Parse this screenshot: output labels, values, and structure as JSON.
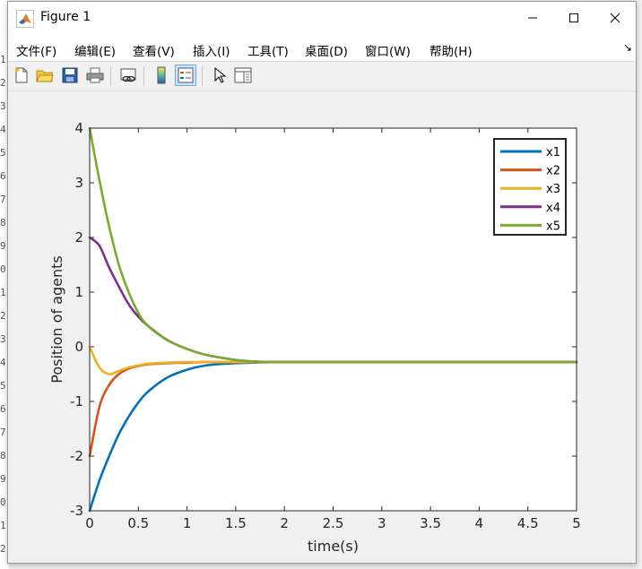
{
  "window": {
    "title": "Figure 1"
  },
  "menu": [
    {
      "label": "文件(F)"
    },
    {
      "label": "编辑(E)"
    },
    {
      "label": "查看(V)"
    },
    {
      "label": "插入(I)"
    },
    {
      "label": "工具(T)"
    },
    {
      "label": "桌面(D)"
    },
    {
      "label": "窗口(W)"
    },
    {
      "label": "帮助(H)"
    }
  ],
  "toolbar": [
    {
      "icon": "new-figure-icon"
    },
    {
      "icon": "open-file-icon"
    },
    {
      "icon": "save-icon"
    },
    {
      "icon": "print-icon"
    },
    {
      "icon": "link-plot-icon"
    },
    {
      "icon": "colorbar-icon"
    },
    {
      "icon": "legend-icon",
      "active": true
    },
    {
      "icon": "edit-plot-cursor-icon"
    },
    {
      "icon": "property-inspector-icon"
    }
  ],
  "colors": {
    "x1": "#0072BD",
    "x2": "#D95319",
    "x3": "#EDB120",
    "x4": "#7E2F8E",
    "x5": "#77AC30"
  },
  "chart_data": {
    "type": "line",
    "xlabel": "time(s)",
    "ylabel": "Position of agents",
    "xlim": [
      0,
      5
    ],
    "ylim": [
      -3,
      4
    ],
    "xticks": [
      "0",
      "0.5",
      "1",
      "1.5",
      "2",
      "2.5",
      "3",
      "3.5",
      "4",
      "4.5",
      "5"
    ],
    "yticks": [
      "-3",
      "-2",
      "-1",
      "0",
      "1",
      "2",
      "3",
      "4"
    ],
    "legend_position": "top-right",
    "grid": false,
    "x": [
      0,
      0.1,
      0.2,
      0.3,
      0.4,
      0.5,
      0.6,
      0.8,
      1.0,
      1.2,
      1.5,
      1.7,
      2.0,
      3.0,
      4.0,
      5.0
    ],
    "series": [
      {
        "name": "x1",
        "values": [
          -3,
          -2.45,
          -2.0,
          -1.6,
          -1.28,
          -1.02,
          -0.82,
          -0.56,
          -0.42,
          -0.34,
          -0.3,
          -0.29,
          -0.28,
          -0.28,
          -0.28,
          -0.28
        ]
      },
      {
        "name": "x2",
        "values": [
          -2,
          -1.1,
          -0.7,
          -0.5,
          -0.4,
          -0.35,
          -0.32,
          -0.3,
          -0.29,
          -0.28,
          -0.28,
          -0.28,
          -0.28,
          -0.28,
          -0.28,
          -0.28
        ]
      },
      {
        "name": "x3",
        "values": [
          0,
          -0.38,
          -0.5,
          -0.44,
          -0.38,
          -0.34,
          -0.31,
          -0.29,
          -0.28,
          -0.28,
          -0.28,
          -0.28,
          -0.28,
          -0.28,
          -0.28,
          -0.28
        ]
      },
      {
        "name": "x4",
        "values": [
          2,
          1.85,
          1.45,
          1.1,
          0.78,
          0.55,
          0.38,
          0.12,
          -0.04,
          -0.15,
          -0.24,
          -0.27,
          -0.28,
          -0.28,
          -0.28,
          -0.28
        ]
      },
      {
        "name": "x5",
        "values": [
          4,
          3.05,
          2.2,
          1.5,
          1.0,
          0.62,
          0.38,
          0.12,
          -0.04,
          -0.15,
          -0.24,
          -0.27,
          -0.28,
          -0.28,
          -0.28,
          -0.28
        ]
      }
    ]
  }
}
